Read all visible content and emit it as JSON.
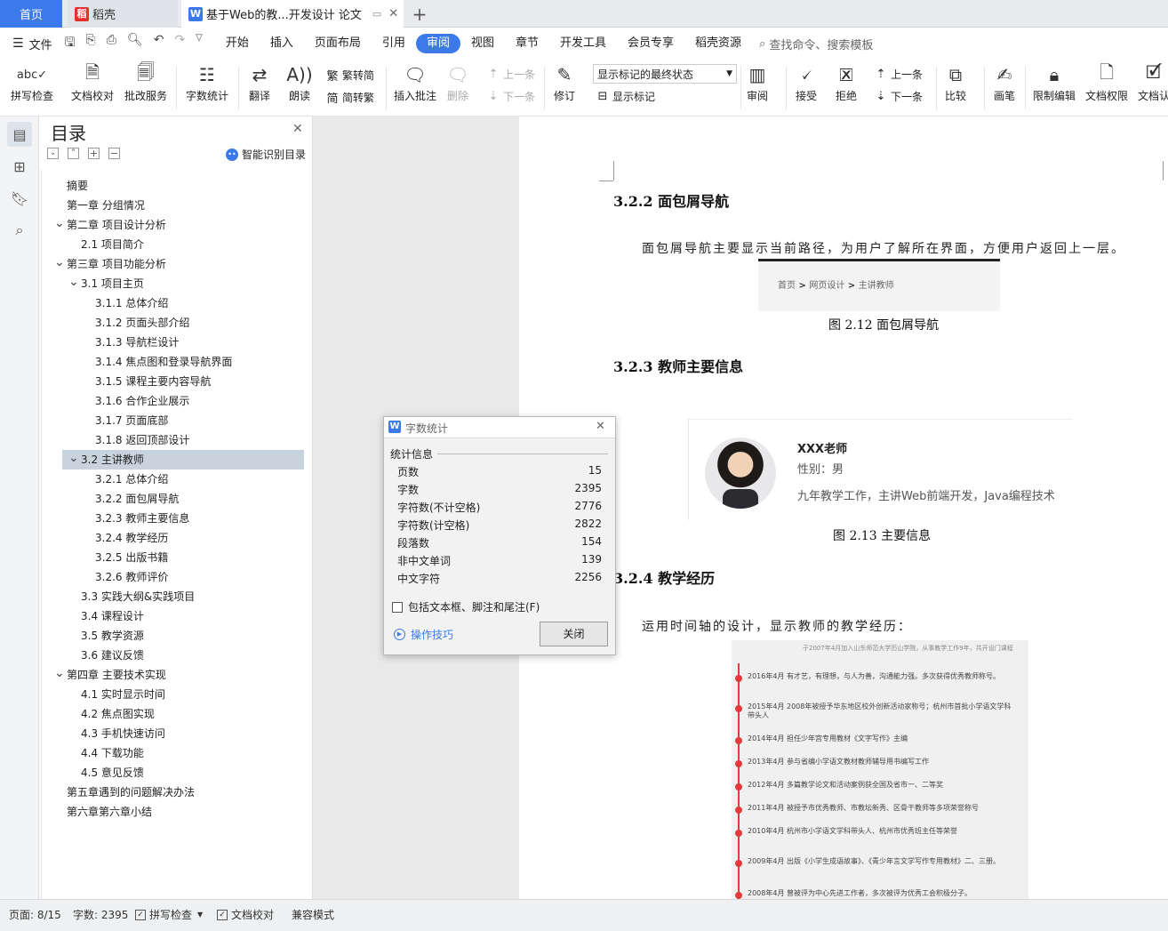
{
  "tabs": {
    "home": "首页",
    "daoke": "稻壳",
    "doc": "基于Web的教...开发设计 论文"
  },
  "menu": {
    "file": "文件",
    "items": [
      "开始",
      "插入",
      "页面布局",
      "引用",
      "审阅",
      "视图",
      "章节",
      "开发工具",
      "会员专享",
      "稻壳资源"
    ],
    "active": "审阅",
    "search_placeholder": "查找命令、搜索模板"
  },
  "ribbon": {
    "spell": "拼写检查",
    "proof": "文档校对",
    "batch": "批改服务",
    "wordcount": "字数统计",
    "translate": "翻译",
    "read": "朗读",
    "trad": "繁转简",
    "simp": "简转繁",
    "insert_comment": "插入批注",
    "delete": "删除",
    "prev": "上一条",
    "next": "下一条",
    "revise": "修订",
    "markup_select": "显示标记的最终状态",
    "show_markup": "显示标记",
    "review": "审阅",
    "accept": "接受",
    "reject": "拒绝",
    "prev2": "上一条",
    "next2": "下一条",
    "compare": "比较",
    "pen": "画笔",
    "restrict": "限制编辑",
    "perm": "文档权限",
    "docv": "文档认"
  },
  "nav": {
    "title": "目录",
    "smart": "智能识别目录",
    "toc": [
      {
        "text": "摘要",
        "level": 1,
        "chev": ""
      },
      {
        "text": "第一章 分组情况",
        "level": 1,
        "chev": ""
      },
      {
        "text": "第二章 项目设计分析",
        "level": 1,
        "chev": "v"
      },
      {
        "text": "2.1 项目简介",
        "level": 2,
        "chev": ""
      },
      {
        "text": "第三章 项目功能分析",
        "level": 1,
        "chev": "v"
      },
      {
        "text": "3.1 项目主页",
        "level": 2,
        "chev": "v"
      },
      {
        "text": "3.1.1 总体介绍",
        "level": 3,
        "chev": ""
      },
      {
        "text": "3.1.2 页面头部介绍",
        "level": 3,
        "chev": ""
      },
      {
        "text": "3.1.3 导航栏设计",
        "level": 3,
        "chev": ""
      },
      {
        "text": "3.1.4 焦点图和登录导航界面",
        "level": 3,
        "chev": ""
      },
      {
        "text": "3.1.5 课程主要内容导航",
        "level": 3,
        "chev": ""
      },
      {
        "text": "3.1.6 合作企业展示",
        "level": 3,
        "chev": ""
      },
      {
        "text": "3.1.7 页面底部",
        "level": 3,
        "chev": ""
      },
      {
        "text": "3.1.8 返回顶部设计",
        "level": 3,
        "chev": ""
      },
      {
        "text": "3.2 主讲教师",
        "level": 2,
        "chev": "v",
        "selected": true
      },
      {
        "text": "3.2.1 总体介绍",
        "level": 3,
        "chev": ""
      },
      {
        "text": "3.2.2 面包屑导航",
        "level": 3,
        "chev": ""
      },
      {
        "text": "3.2.3 教师主要信息",
        "level": 3,
        "chev": ""
      },
      {
        "text": "3.2.4 教学经历",
        "level": 3,
        "chev": ""
      },
      {
        "text": "3.2.5 出版书籍",
        "level": 3,
        "chev": ""
      },
      {
        "text": "3.2.6 教师评价",
        "level": 3,
        "chev": ""
      },
      {
        "text": "3.3 实践大纲&实践项目",
        "level": 2,
        "chev": ""
      },
      {
        "text": "3.4 课程设计",
        "level": 2,
        "chev": ""
      },
      {
        "text": "3.5 教学资源",
        "level": 2,
        "chev": ""
      },
      {
        "text": "3.6 建议反馈",
        "level": 2,
        "chev": ""
      },
      {
        "text": "第四章 主要技术实现",
        "level": 1,
        "chev": "v"
      },
      {
        "text": "4.1 实时显示时间",
        "level": 2,
        "chev": ""
      },
      {
        "text": "4.2 焦点图实现",
        "level": 2,
        "chev": ""
      },
      {
        "text": "4.3 手机快速访问",
        "level": 2,
        "chev": ""
      },
      {
        "text": "4.4 下载功能",
        "level": 2,
        "chev": ""
      },
      {
        "text": "4.5 意见反馈",
        "level": 2,
        "chev": ""
      },
      {
        "text": "第五章遇到的问题解决办法",
        "level": 1,
        "chev": ""
      },
      {
        "text": "第六章第六章小结",
        "level": 1,
        "chev": ""
      }
    ]
  },
  "doc": {
    "h322": "3.2.2 面包屑导航",
    "p322": "面包屑导航主要显示当前路径，为用户了解所在界面，方便用户返回上一层。",
    "breadcrumb": {
      "home": "首页",
      "design": "网页设计",
      "teacher": "主讲教师"
    },
    "cap212": "图 2.12 面包屑导航",
    "h323": "3.2.3 教师主要信息",
    "teacher_name": "XXX老师",
    "teacher_gender": "性别：男",
    "teacher_desc": "九年教学工作，主讲Web前端开发，Java编程技术",
    "cap213": "图 2.13  主要信息",
    "h324": "3.2.4 教学经历",
    "p324": "运用时间轴的设计，显示教师的教学经历：",
    "timeline_header": "于2007年4月加入山东师范大学历山学院，从事教学工作9年，共开设门课程",
    "timeline": [
      "2016年4月  有才艺，有理想，与人为善，沟通能力强。多次获得优秀教师称号。",
      "2015年4月  2008年被授予华东地区校外创新活动家称号；杭州市首批小学语文学科带头人",
      "2014年4月  担任少年宫专用教材《文字写作》主编",
      "2013年4月  参与省编小学语文教材教师辅导用书编写工作",
      "2012年4月  多篇教学论文和活动案例获全国及省市一、二等奖",
      "2011年4月  被授予市优秀教师、市教坛新秀、区骨干教师等多项荣誉称号",
      "2010年4月  杭州市小学语文学科带头人、杭州市优秀班主任等荣誉",
      "2009年4月  出版《小学生成语故事》、《青少年言文学写作专用教材》二、三册。",
      "2008年4月  曾被评为中心先进工作者，多次被评为优秀工会积极分子。"
    ]
  },
  "dialog": {
    "title": "字数统计",
    "section": "统计信息",
    "rows": [
      {
        "label": "页数",
        "value": "15"
      },
      {
        "label": "字数",
        "value": "2395"
      },
      {
        "label": "字符数(不计空格)",
        "value": "2776"
      },
      {
        "label": "字符数(计空格)",
        "value": "2822"
      },
      {
        "label": "段落数",
        "value": "154"
      },
      {
        "label": "非中文单词",
        "value": "139"
      },
      {
        "label": "中文字符",
        "value": "2256"
      }
    ],
    "checkbox": "包括文本框、脚注和尾注(F)",
    "tips": "操作技巧",
    "close": "关闭"
  },
  "status": {
    "page": "页面: 8/15",
    "words": "字数: 2395",
    "spell": "拼写检查",
    "proof": "文档校对",
    "compat": "兼容模式"
  },
  "colors": {
    "accent": "#3b7ae8",
    "timeline_red": "#e23b3b"
  }
}
